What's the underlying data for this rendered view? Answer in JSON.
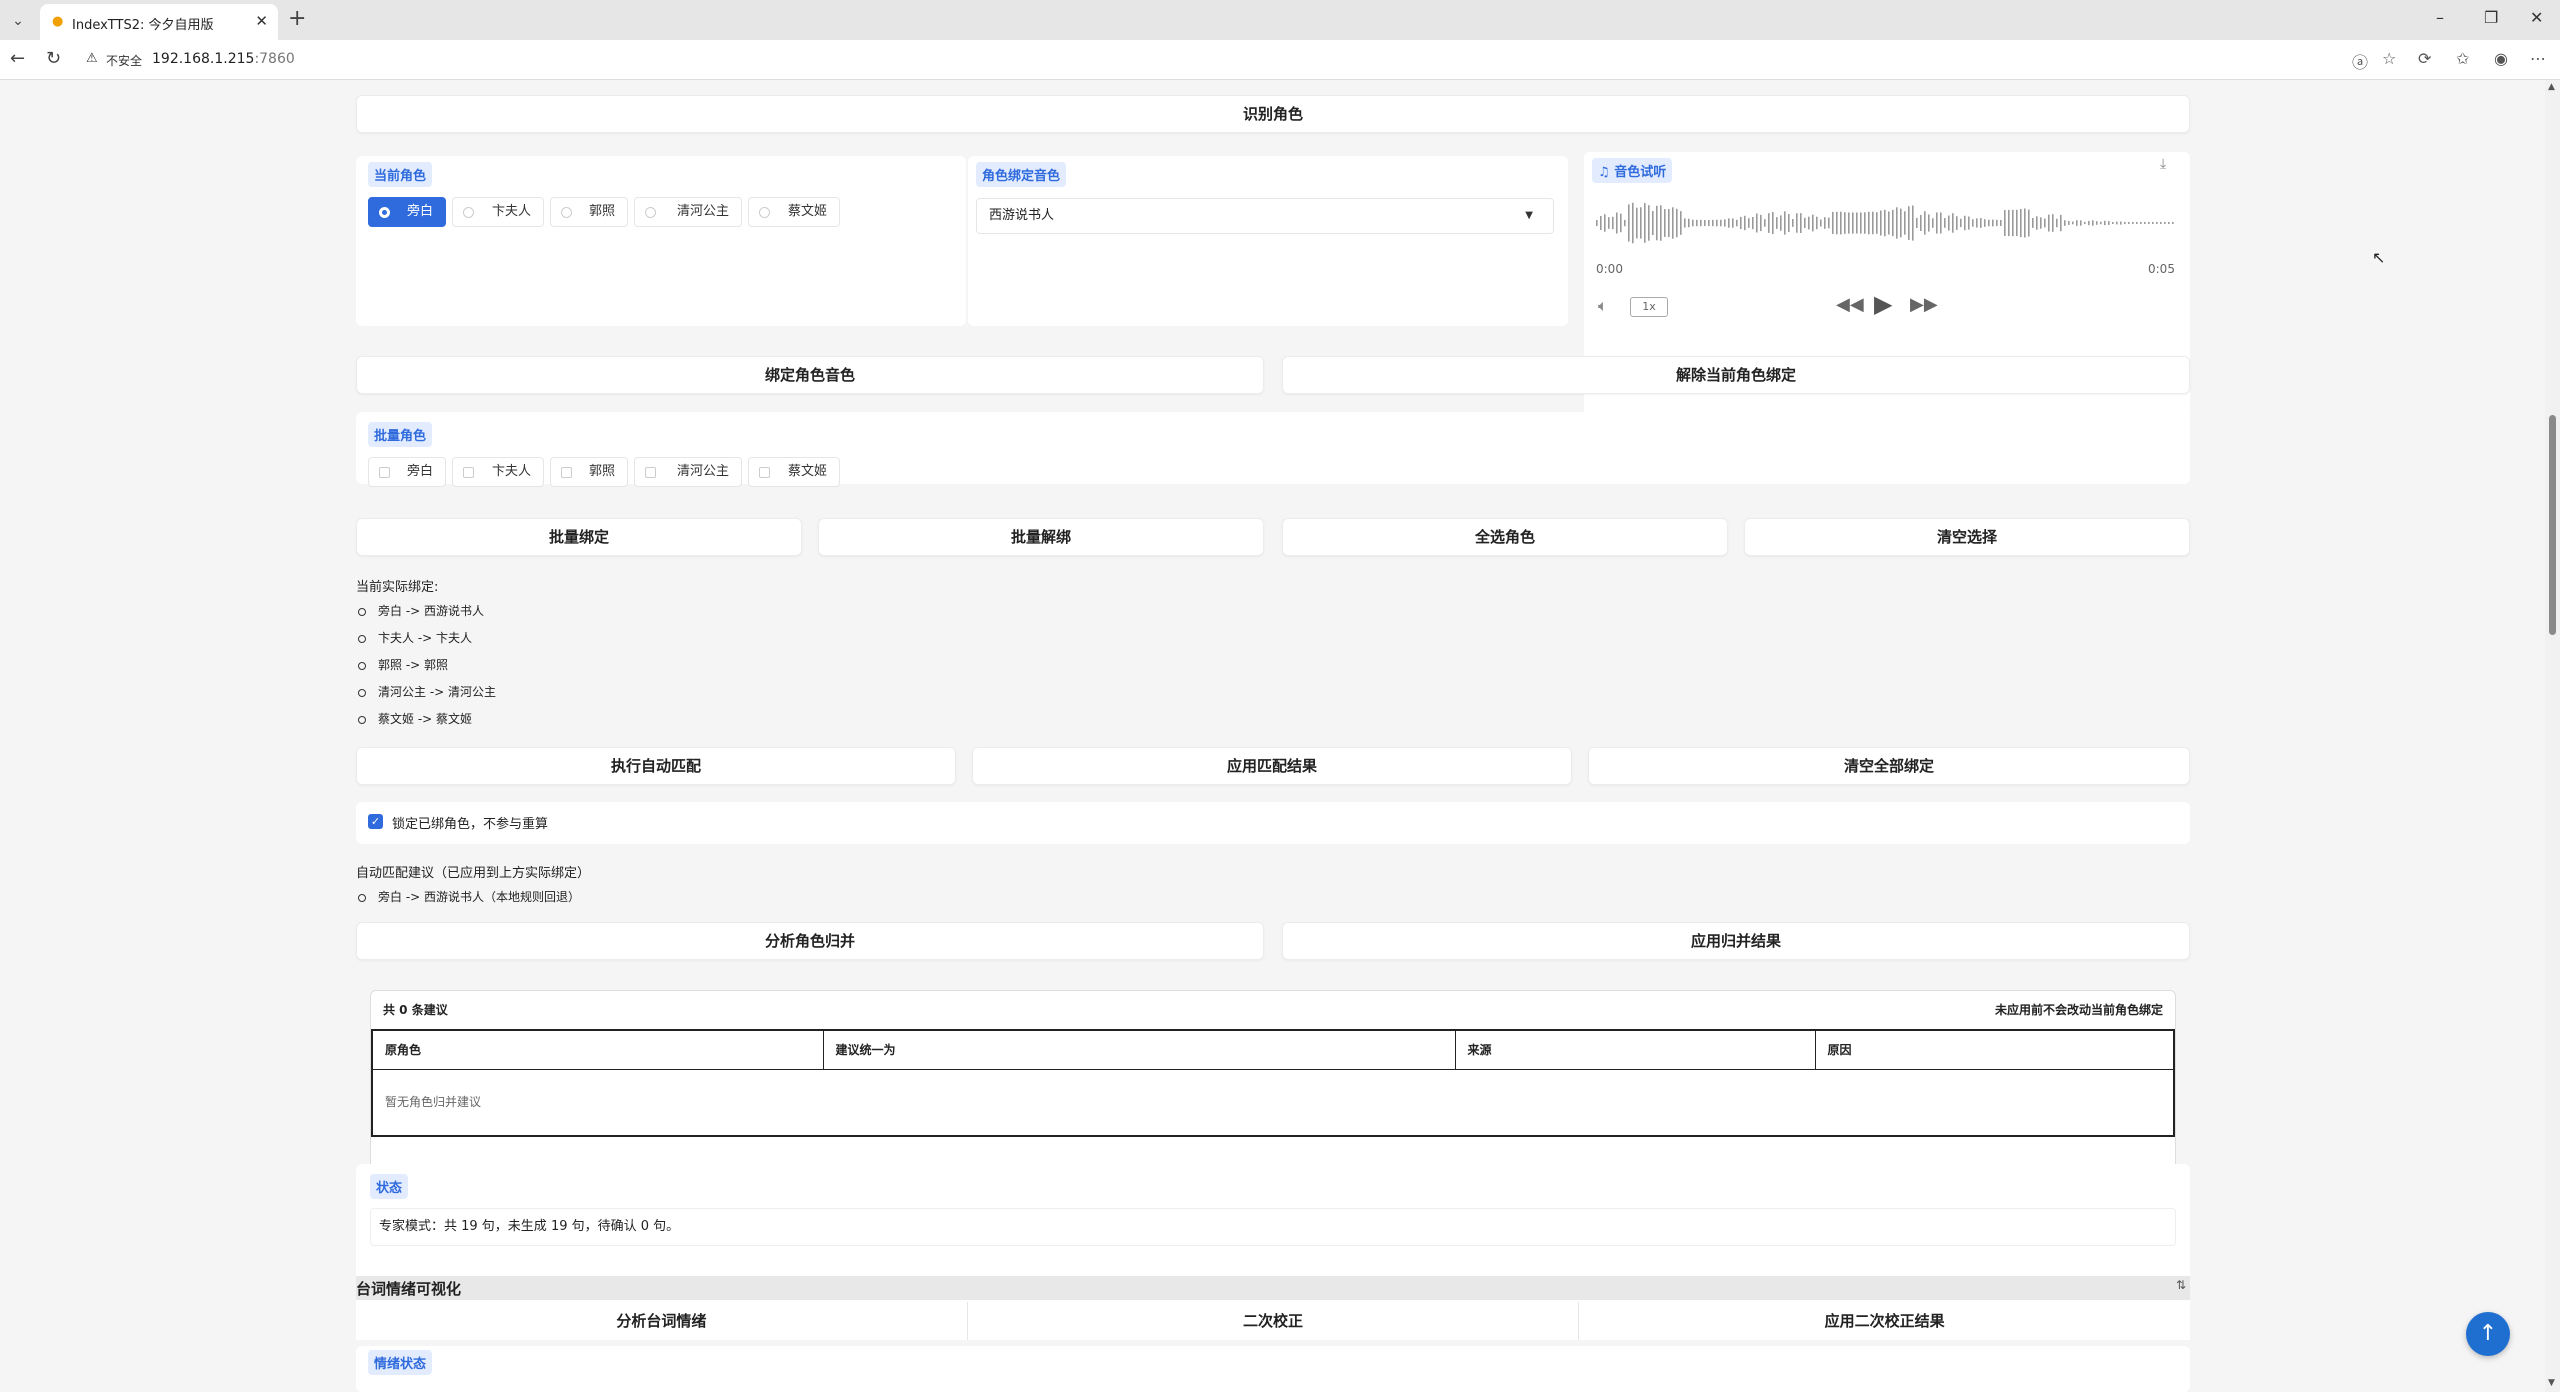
{
  "browser": {
    "tab_title": "IndexTTS2: 今夕自用版",
    "insecure_label": "不安全",
    "url_host": "192.168.1.215",
    "url_port": ":7860"
  },
  "identify_button": "识别角色",
  "current_role": {
    "label": "当前角色",
    "options": [
      "旁白",
      "卞夫人",
      "郭照",
      "清河公主",
      "蔡文姬"
    ],
    "selected": "旁白"
  },
  "bound_voice": {
    "label": "角色绑定音色",
    "value": "西游说书人"
  },
  "audio": {
    "label": "音色试听",
    "time_start": "0:00",
    "time_end": "0:05",
    "speed": "1x"
  },
  "bind_buttons": {
    "bind": "绑定角色音色",
    "unbind": "解除当前角色绑定"
  },
  "batch_roles": {
    "label": "批量角色",
    "options": [
      "旁白",
      "卞夫人",
      "郭照",
      "清河公主",
      "蔡文姬"
    ]
  },
  "batch_buttons": [
    "批量绑定",
    "批量解绑",
    "全选角色",
    "清空选择"
  ],
  "current_bindings": {
    "title": "当前实际绑定:",
    "items": [
      "旁白 -> 西游说书人",
      "卞夫人 -> 卞夫人",
      "郭照 -> 郭照",
      "清河公主 -> 清河公主",
      "蔡文姬 -> 蔡文姬"
    ]
  },
  "match_buttons": [
    "执行自动匹配",
    "应用匹配结果",
    "清空全部绑定"
  ],
  "lock_checkbox": {
    "label": "锁定已绑角色，不参与重算",
    "checked": true
  },
  "auto_suggest": {
    "title": "自动匹配建议（已应用到上方实际绑定）",
    "items": [
      "旁白 -> 西游说书人（本地规则回退）"
    ]
  },
  "merge_buttons": [
    "分析角色归并",
    "应用归并结果"
  ],
  "merge_table": {
    "count": "共 0 条建议",
    "note": "未应用前不会改动当前角色绑定",
    "headers": [
      "原角色",
      "建议统一为",
      "来源",
      "原因"
    ],
    "empty": "暂无角色归并建议"
  },
  "status": {
    "label": "状态",
    "text": "专家模式：共 19 句，未生成 19 句，待确认 0 句。"
  },
  "emotion": {
    "title": "台词情绪可视化",
    "buttons": [
      "分析台词情绪",
      "二次校正",
      "应用二次校正结果"
    ],
    "status_label": "情绪状态"
  }
}
